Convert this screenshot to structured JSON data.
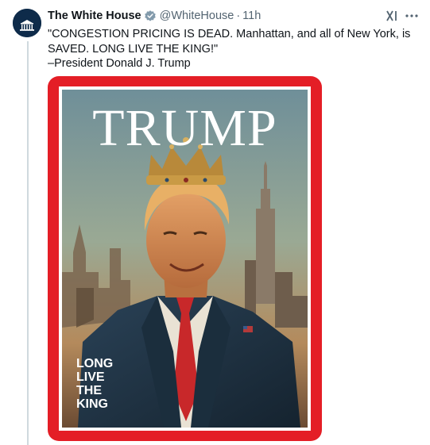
{
  "tweet": {
    "author_name": "The White House",
    "handle": "@WhiteHouse",
    "separator": "·",
    "time": "11h",
    "verified_badge_icon": "gov-verified-badge-icon",
    "grok_icon": "grok-icon",
    "more_icon": "more-options-icon",
    "text_lines": [
      "\"CONGESTION PRICING IS DEAD. Manhattan, and all of New York, is SAVED. LONG LIVE THE KING!\"",
      "–President Donald J. Trump"
    ]
  },
  "media": {
    "masthead": "TRUMP",
    "cover_lines": [
      "LONG",
      "LIVE",
      "THE",
      "KING"
    ],
    "border_color": "#e41e26"
  },
  "colors": {
    "text": "#0f1419",
    "secondary": "#536471",
    "thread_line": "#cfd9de",
    "badge": "#829aab"
  }
}
